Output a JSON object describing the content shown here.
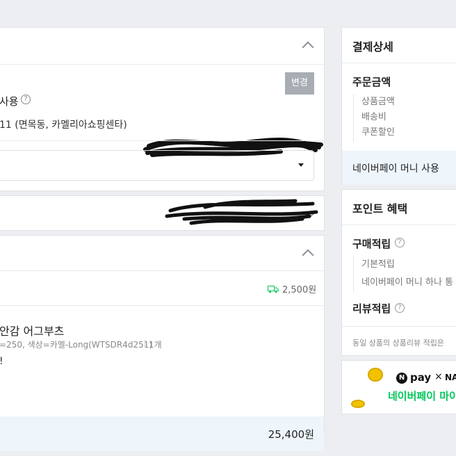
{
  "shipping": {
    "change_button": "변경",
    "address_suffix": "사용",
    "address_line": "11 (면목동, 카멜리아쇼핑센타)"
  },
  "order": {
    "shipping_fee": "2,500원",
    "product_name": "안감 어그부츠",
    "product_option": "=250, 색상=카멜-Long(WTSDR4d251)",
    "product_qty": "1개",
    "partial_char": "!",
    "total": "25,400원"
  },
  "payment_detail": {
    "title": "결제상세",
    "order_amount_label": "주문금액",
    "items": [
      "상품금액",
      "배송비",
      "쿠폰할인"
    ],
    "naverpay_money": "네이버페이 머니 사용"
  },
  "point_benefit": {
    "title": "포인트 혜택",
    "purchase_label": "구매적립",
    "purchase_items": [
      "기본적립",
      "네이버페이 머니 하나 통"
    ],
    "review_label": "리뷰적립",
    "review_note": "동일 상품의 상품리뷰 적립은"
  },
  "banner": {
    "logo_text": "pay",
    "logo_n": "N",
    "logo_x": "×",
    "logo_partner": "NAV",
    "tagline": "네이버페이 마이"
  },
  "colors": {
    "accent_green": "#03c75a",
    "button_gray": "#a8adb4"
  }
}
